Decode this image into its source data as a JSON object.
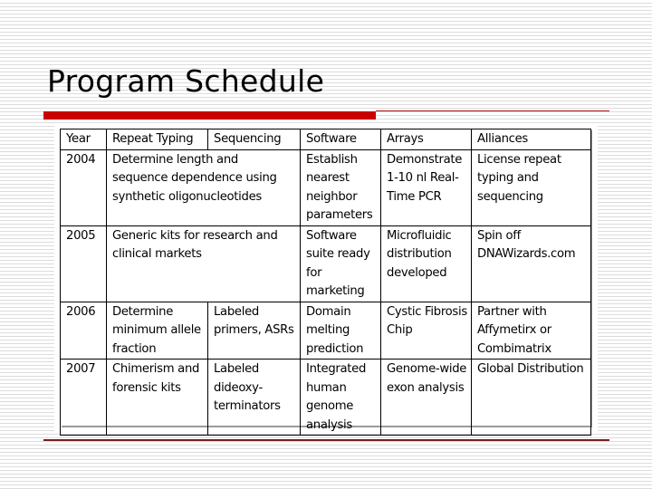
{
  "slide": {
    "title": "Program Schedule",
    "colors": {
      "accent_red": "#c80000",
      "rule_dark": "#7a1e1e",
      "stripe": "#dcdcdc"
    }
  },
  "table": {
    "header": {
      "year": "Year",
      "repeat_typing": "Repeat Typing",
      "sequencing": "Sequencing",
      "software": "Software",
      "arrays": "Arrays",
      "alliances": "Alliances"
    },
    "rows": [
      {
        "year": "2004",
        "repeat_sequencing": "Determine length and sequence dependence using synthetic oligonucleotides",
        "software": "Establish nearest neighbor parameters",
        "arrays": "Demonstrate 1-10 nl Real-Time PCR",
        "alliances": "License repeat typing and sequencing"
      },
      {
        "year": "2005",
        "repeat_sequencing": "Generic kits for research and clinical markets",
        "software": "Software suite ready for marketing",
        "arrays": "Microfluidic distribution developed",
        "alliances": "Spin off DNAWizards.com"
      },
      {
        "year": "2006",
        "repeat_typing": "Determine minimum allele fraction",
        "sequencing": "Labeled primers, ASRs",
        "software": "Domain melting prediction",
        "arrays": "Cystic Fibrosis Chip",
        "alliances": "Partner with Affymetirx or Combimatrix"
      },
      {
        "year": "2007",
        "repeat_typing": "Chimerism and forensic kits",
        "sequencing": "Labeled dideoxy-terminators",
        "software": "Integrated human genome analysis",
        "arrays": "Genome-wide exon analysis",
        "alliances": "Global Distribution"
      }
    ]
  }
}
